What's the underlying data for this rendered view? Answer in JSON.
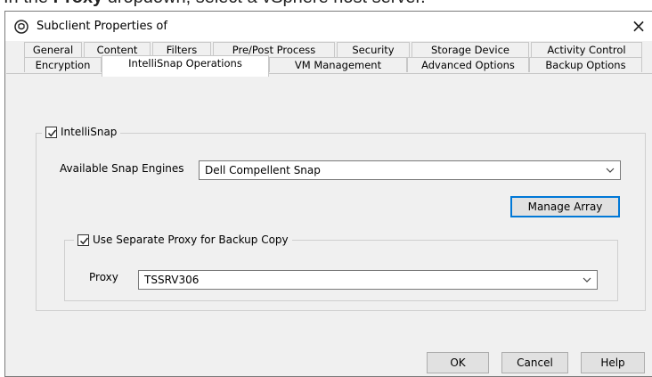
{
  "doc_header": {
    "prefix": "In the ",
    "bold": "Proxy",
    "suffix": " dropdown, select a vSphere host server."
  },
  "window": {
    "title": "Subclient Properties of",
    "close_glyph": "×"
  },
  "tabs": {
    "row_back": [
      "General",
      "Content",
      "Filters",
      "Pre/Post Process",
      "Security",
      "Storage Device",
      "Activity Control"
    ],
    "row_front": [
      "Encryption",
      "IntelliSnap Operations",
      "VM Management",
      "Advanced Options",
      "Backup Options"
    ],
    "active": "IntelliSnap Operations"
  },
  "intellisnap": {
    "checkbox_label": "IntelliSnap",
    "checked": true,
    "engines_label": "Available Snap Engines",
    "engine_value": "Dell Compellent Snap",
    "manage_array_label": "Manage Array"
  },
  "proxy_group": {
    "checkbox_label": "Use Separate Proxy for Backup Copy",
    "checked": true,
    "proxy_label": "Proxy",
    "proxy_value": "TSSRV306"
  },
  "footer": {
    "ok_label": "OK",
    "cancel_label": "Cancel",
    "help_label": "Help"
  },
  "colors": {
    "dialog_bg": "#f0f0f0",
    "focus_border": "#0078d7",
    "button_bg": "#e1e1e1"
  },
  "icons": {
    "app_icon": "commvault-shield-icon",
    "close_icon": "close-icon",
    "check_icon": "checkmark-icon",
    "dropdown_icon": "chevron-down-icon"
  }
}
